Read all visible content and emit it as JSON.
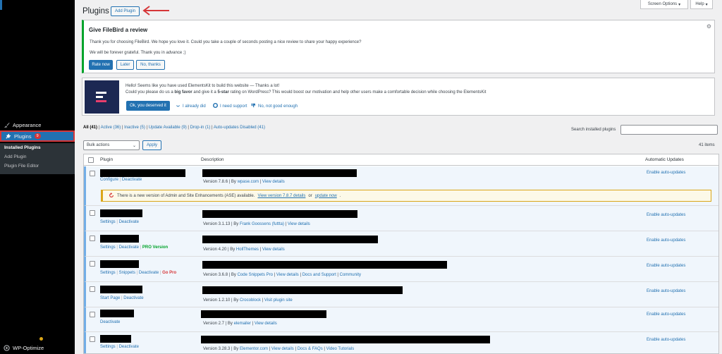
{
  "sidebar": {
    "appearance": "Appearance",
    "plugins": "Plugins",
    "plugins_badge": "9",
    "submenu": [
      "Installed Plugins",
      "Add Plugin",
      "Plugin File Editor"
    ],
    "wp_optimize": "WP-Optimize"
  },
  "header": {
    "title": "Plugins",
    "add_plugin": "Add Plugin",
    "screen_options": "Screen Options",
    "help": "Help"
  },
  "review_notice": {
    "title": "Give FileBird a review",
    "p1": "Thank you for choosing FileBird. We hope you love it. Could you take a couple of seconds posting a nice review to share your happy experience?",
    "p2": "We will be forever grateful. Thank you in advance ;)",
    "rate_now": "Rate now",
    "later": "Later",
    "no_thanks": "No, thanks"
  },
  "ek_notice": {
    "line1": "Hello! Seems like you have used ElementsKit to build this website — Thanks a lot!",
    "line2_a": "Could you please do us a ",
    "line2_b": "big favor",
    "line2_c": " and give it a ",
    "line2_d": "5-star",
    "line2_e": " rating on WordPress? This would boost our motivation and help other users make a comfortable decision while choosing the ElementsKit",
    "ok_btn": "Ok, you deserved it",
    "already": "I already did",
    "support": "I need support",
    "no_good": "No, not good enough"
  },
  "filters": {
    "all": "All",
    "all_count": "(41)",
    "active": "Active",
    "active_count": "(36)",
    "inactive": "Inactive",
    "inactive_count": "(5)",
    "update": "Update Available",
    "update_count": "(9)",
    "dropin": "Drop-in",
    "dropin_count": "(1)",
    "auto_disabled": "Auto-updates Disabled",
    "auto_disabled_count": "(41)",
    "search_label": "Search installed plugins",
    "bulk_actions": "Bulk actions",
    "apply": "Apply",
    "items": "41 items"
  },
  "table": {
    "col_plugin": "Plugin",
    "col_description": "Description",
    "col_auto": "Automatic Updates",
    "enable_auto": "Enable auto-updates",
    "update_notice": {
      "text": "There is a new version of Admin and Site Enhancements (ASE) available.",
      "view_link": "View version 7.8.7 details",
      "or": " or ",
      "update_link": "update now",
      "end": "."
    },
    "rows": [
      {
        "actions": [
          "Configure",
          "Deactivate"
        ],
        "version": "Version 7.8.6",
        "by": "wpase.com",
        "links": [
          "View details"
        ]
      },
      {
        "actions": [
          "Settings",
          "Deactivate"
        ],
        "version": "Version 3.1.13",
        "by": "Frank Goossens (futtta)",
        "links": [
          "View details"
        ]
      },
      {
        "actions": [
          "Settings",
          "Deactivate"
        ],
        "extra": "PRO Version",
        "version": "Version 4.20",
        "by": "HollThemes",
        "links": [
          "View details"
        ]
      },
      {
        "actions": [
          "Settings",
          "Snippets",
          "Deactivate"
        ],
        "extra": "Go Pro",
        "version": "Version 3.6.8",
        "by": "Code Snippets Pro",
        "links": [
          "View details",
          "Docs and Support",
          "Community"
        ]
      },
      {
        "actions": [
          "Start Page",
          "Deactivate"
        ],
        "version": "Version 1.2.10",
        "by": "Crocoblock",
        "links": [
          "Visit plugin site"
        ]
      },
      {
        "actions": [
          "Deactivate"
        ],
        "version": "Version 2.7",
        "by": "elemailer",
        "links": [
          "View details"
        ]
      },
      {
        "actions": [
          "Settings",
          "Deactivate"
        ],
        "version": "Version 3.28.3",
        "by": "Elementor.com",
        "links": [
          "View details",
          "Docs & FAQs",
          "Video Tutorials"
        ]
      }
    ]
  },
  "colors": {
    "accent": "#2271b1",
    "sidebar": "#000000",
    "review_border": "#00a32a",
    "warning": "#dba617",
    "danger": "#d63638"
  }
}
